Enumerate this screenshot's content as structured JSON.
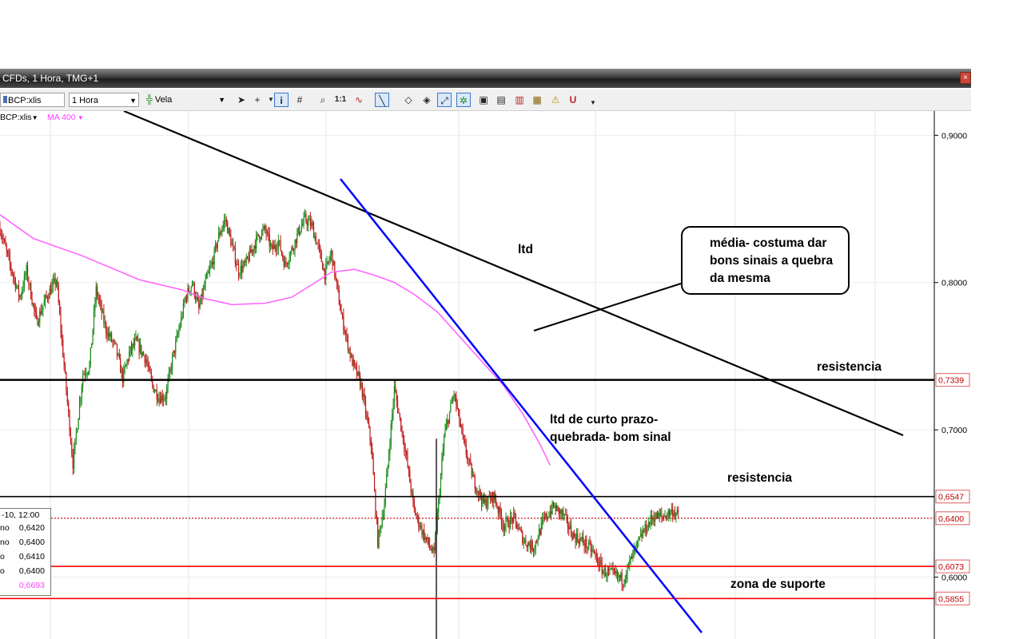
{
  "window": {
    "title": "CFDs, 1 Hora, TMG+1",
    "close_icon": "close-icon"
  },
  "toolbar": {
    "symbol_value": "BCP:xlis",
    "interval_value": "1 Hora",
    "chart_style_value": "Vela",
    "tool_icons": [
      "cursor-icon",
      "crosshair-icon",
      "info-icon",
      "grid-icon",
      "zoom-icon",
      "ratio-icon",
      "indicator-icon",
      "trendline-icon",
      "eraser-icon",
      "paint-icon",
      "measure-icon",
      "pattern-icon",
      "gallery-icon-1",
      "gallery-icon-2",
      "gallery-icon-3",
      "gallery-icon-4",
      "alert-icon",
      "magnet-icon"
    ]
  },
  "legend": {
    "symbol": "BCP:xlis",
    "indicator": "MA 400"
  },
  "infobox": {
    "header": "-10, 12:00",
    "rows": [
      {
        "label": "no",
        "value": "0,6420"
      },
      {
        "label": "no",
        "value": "0,6400"
      },
      {
        "label": "o",
        "value": "0,6410"
      },
      {
        "label": "o",
        "value": "0,6400"
      },
      {
        "label": "",
        "value": "0,6693"
      }
    ]
  },
  "annotations": {
    "callout": "média- costuma dar\nbons sinais a quebra\nda mesma",
    "ltd": "ltd",
    "resist_upper": "resistencia",
    "ltd_short": "ltd de curto prazo-\nquebrada- bom sinal",
    "resist_lower": "resistencia",
    "support": "zona de suporte"
  },
  "colors": {
    "candle_up": "#1a8a1a",
    "candle_down": "#c01818",
    "ma": "#ff60ff",
    "trend_blue": "#0000ff",
    "level_red": "#ff0000",
    "label_red_border": "#e06060"
  },
  "chart_data": {
    "type": "candlestick",
    "symbol": "BCP:xlis",
    "interval": "1 Hora",
    "y_axis": {
      "range": [
        0.558,
        0.917
      ],
      "ticks": [
        {
          "value": 0.9,
          "label": "0,9000"
        },
        {
          "value": 0.8,
          "label": "0,8000"
        },
        {
          "value": 0.7,
          "label": "0,7000"
        },
        {
          "value": 0.6,
          "label": "0,6000"
        }
      ]
    },
    "x_range": [
      0,
      100
    ],
    "price_path": [
      [
        0,
        0.837
      ],
      [
        3,
        0.812
      ],
      [
        6,
        0.79
      ],
      [
        8,
        0.808
      ],
      [
        11,
        0.773
      ],
      [
        14,
        0.79
      ],
      [
        17,
        0.802
      ],
      [
        19,
        0.752
      ],
      [
        22,
        0.677
      ],
      [
        25,
        0.738
      ],
      [
        27,
        0.743
      ],
      [
        29,
        0.795
      ],
      [
        32,
        0.768
      ],
      [
        35,
        0.755
      ],
      [
        37,
        0.735
      ],
      [
        39,
        0.752
      ],
      [
        41,
        0.76
      ],
      [
        44,
        0.748
      ],
      [
        46,
        0.73
      ],
      [
        48,
        0.722
      ],
      [
        50,
        0.723
      ],
      [
        52,
        0.748
      ],
      [
        54,
        0.768
      ],
      [
        56,
        0.79
      ],
      [
        58,
        0.8
      ],
      [
        60,
        0.782
      ],
      [
        62,
        0.8
      ],
      [
        64,
        0.813
      ],
      [
        66,
        0.832
      ],
      [
        68,
        0.843
      ],
      [
        70,
        0.825
      ],
      [
        72,
        0.808
      ],
      [
        74,
        0.812
      ],
      [
        76,
        0.822
      ],
      [
        78,
        0.832
      ],
      [
        80,
        0.836
      ],
      [
        82,
        0.822
      ],
      [
        84,
        0.828
      ],
      [
        86,
        0.812
      ],
      [
        88,
        0.822
      ],
      [
        90,
        0.834
      ],
      [
        92,
        0.843
      ],
      [
        94,
        0.839
      ],
      [
        96,
        0.824
      ],
      [
        98,
        0.806
      ],
      [
        100,
        0.82
      ],
      [
        103,
        0.778
      ],
      [
        106,
        0.748
      ],
      [
        109,
        0.73
      ],
      [
        112,
        0.69
      ],
      [
        114,
        0.624
      ],
      [
        116,
        0.65
      ],
      [
        119,
        0.728
      ],
      [
        122,
        0.69
      ],
      [
        125,
        0.645
      ],
      [
        128,
        0.628
      ],
      [
        131,
        0.615
      ],
      [
        134,
        0.695
      ],
      [
        137,
        0.725
      ],
      [
        140,
        0.69
      ],
      [
        143,
        0.665
      ],
      [
        146,
        0.65
      ],
      [
        149,
        0.655
      ],
      [
        152,
        0.635
      ],
      [
        155,
        0.64
      ],
      [
        158,
        0.625
      ],
      [
        161,
        0.62
      ],
      [
        164,
        0.638
      ],
      [
        167,
        0.648
      ],
      [
        170,
        0.642
      ],
      [
        173,
        0.628
      ],
      [
        176,
        0.624
      ],
      [
        179,
        0.617
      ],
      [
        182,
        0.604
      ],
      [
        185,
        0.602
      ],
      [
        188,
        0.598
      ],
      [
        191,
        0.615
      ],
      [
        194,
        0.63
      ],
      [
        197,
        0.641
      ],
      [
        200,
        0.641
      ],
      [
        203,
        0.645
      ],
      [
        205,
        0.641
      ]
    ],
    "ma400": [
      [
        0,
        0.846
      ],
      [
        10,
        0.83
      ],
      [
        25,
        0.818
      ],
      [
        42,
        0.802
      ],
      [
        55,
        0.795
      ],
      [
        62,
        0.789
      ],
      [
        70,
        0.785
      ],
      [
        80,
        0.786
      ],
      [
        88,
        0.79
      ],
      [
        93,
        0.797
      ],
      [
        100,
        0.807
      ],
      [
        107,
        0.809
      ],
      [
        113,
        0.805
      ],
      [
        119,
        0.8
      ],
      [
        125,
        0.792
      ],
      [
        132,
        0.78
      ],
      [
        140,
        0.76
      ],
      [
        146,
        0.745
      ],
      [
        152,
        0.73
      ],
      [
        158,
        0.71
      ],
      [
        163,
        0.69
      ],
      [
        166,
        0.676
      ]
    ],
    "horizontal_levels": [
      {
        "value": 0.7339,
        "label": "0,7339",
        "color": "#000000",
        "width": 2.5,
        "style": "solid"
      },
      {
        "value": 0.6547,
        "label": "0,6547",
        "color": "#000000",
        "width": 1.6,
        "style": "solid"
      },
      {
        "value": 0.64,
        "label": "0,6400",
        "color": "#cc0000",
        "width": 1.2,
        "style": "dotted"
      },
      {
        "value": 0.6073,
        "label": "0,6073",
        "color": "#ff0000",
        "width": 1.6,
        "style": "solid"
      },
      {
        "value": 0.5855,
        "label": "0,5855",
        "color": "#ff0000",
        "width": 1.6,
        "style": "solid"
      }
    ]
  }
}
